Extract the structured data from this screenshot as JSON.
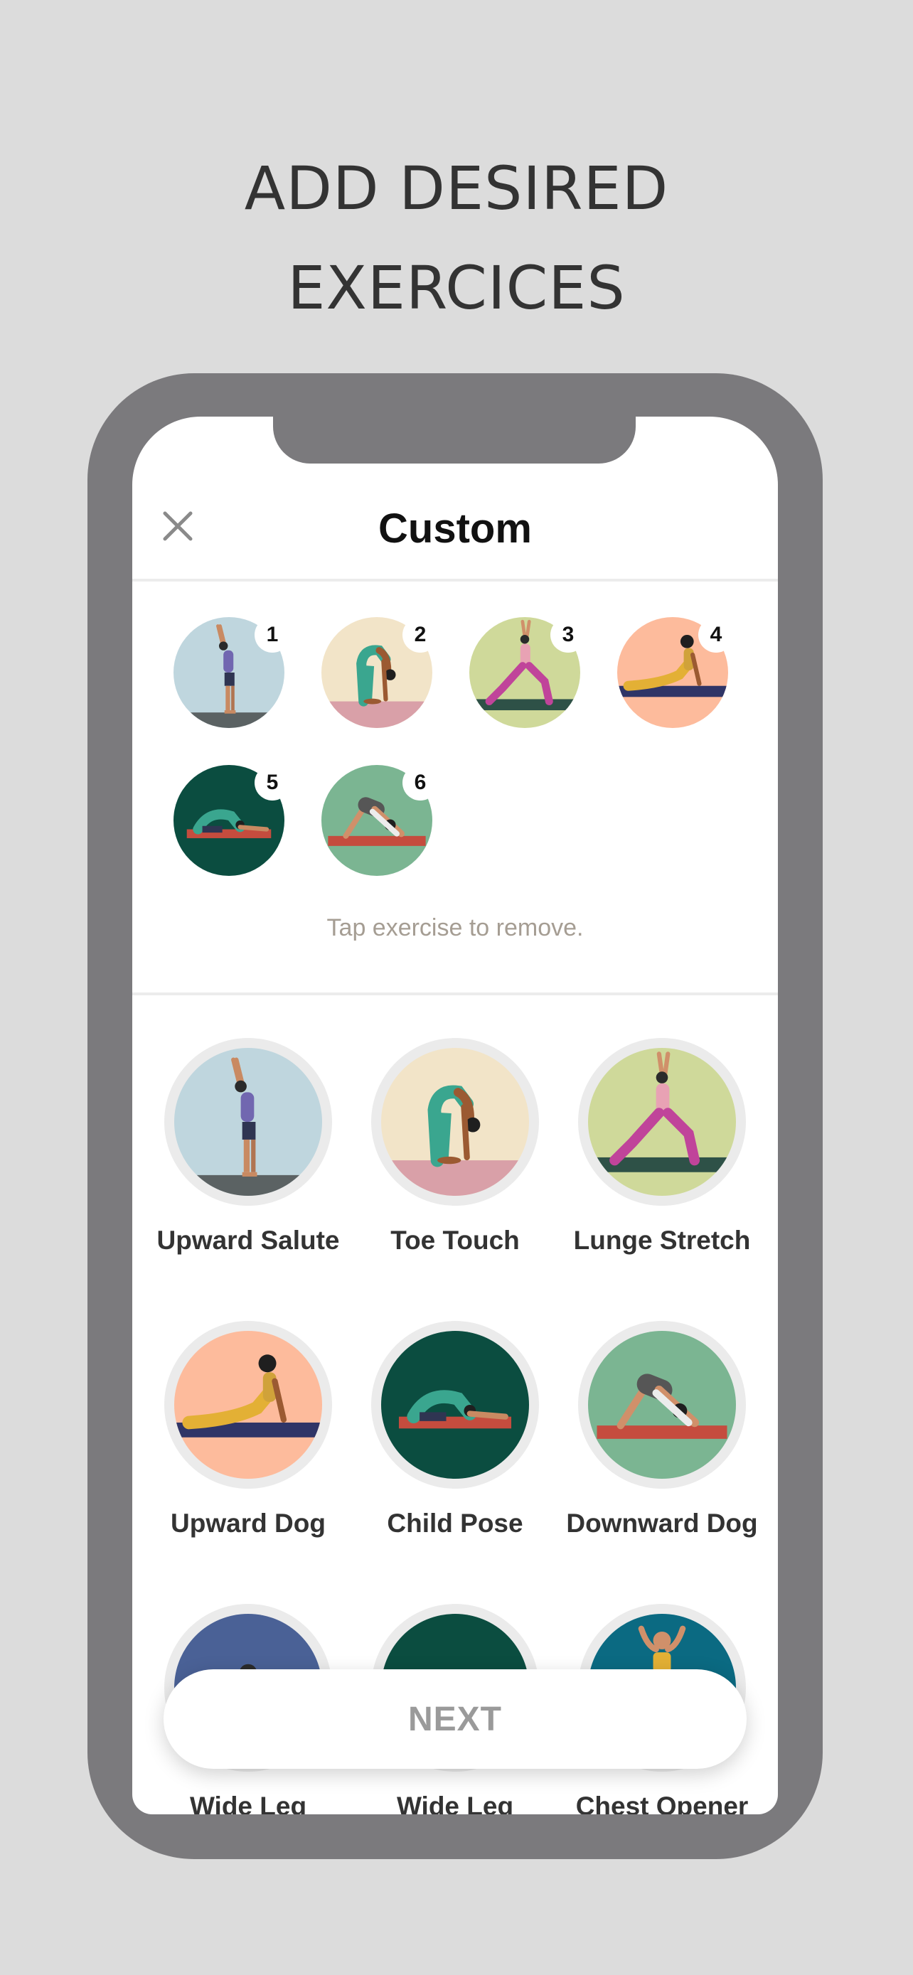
{
  "headline": {
    "line1": "ADD DESIRED",
    "line2": "EXERCICES"
  },
  "header": {
    "title": "Custom",
    "close_icon": "close-icon"
  },
  "selected": [
    {
      "number": "1",
      "exercise": "upward-salute"
    },
    {
      "number": "2",
      "exercise": "toe-touch"
    },
    {
      "number": "3",
      "exercise": "lunge-stretch"
    },
    {
      "number": "4",
      "exercise": "upward-dog"
    },
    {
      "number": "5",
      "exercise": "child-pose"
    },
    {
      "number": "6",
      "exercise": "downward-dog"
    }
  ],
  "hint": "Tap exercise to remove.",
  "exercises": [
    {
      "label": "Upward Salute",
      "bg": "#bfd6de"
    },
    {
      "label": "Toe Touch",
      "bg": "#f2e4c8"
    },
    {
      "label": "Lunge Stretch",
      "bg": "#cfd99a"
    },
    {
      "label": "Upward Dog",
      "bg": "#fdbb9c"
    },
    {
      "label": "Child Pose",
      "bg": "#0b4d40"
    },
    {
      "label": "Downward Dog",
      "bg": "#7bb592"
    },
    {
      "label": "Wide Leg",
      "bg": "#4a6196"
    },
    {
      "label": "Wide Leg",
      "bg": "#0b4d40"
    },
    {
      "label": "Chest Opener",
      "bg": "#0b6a82"
    }
  ],
  "next_button": {
    "label": "NEXT"
  },
  "colors": {
    "background": "#dcdcdc",
    "phone_frame": "#7b7a7d",
    "hint": "#a59d93"
  }
}
